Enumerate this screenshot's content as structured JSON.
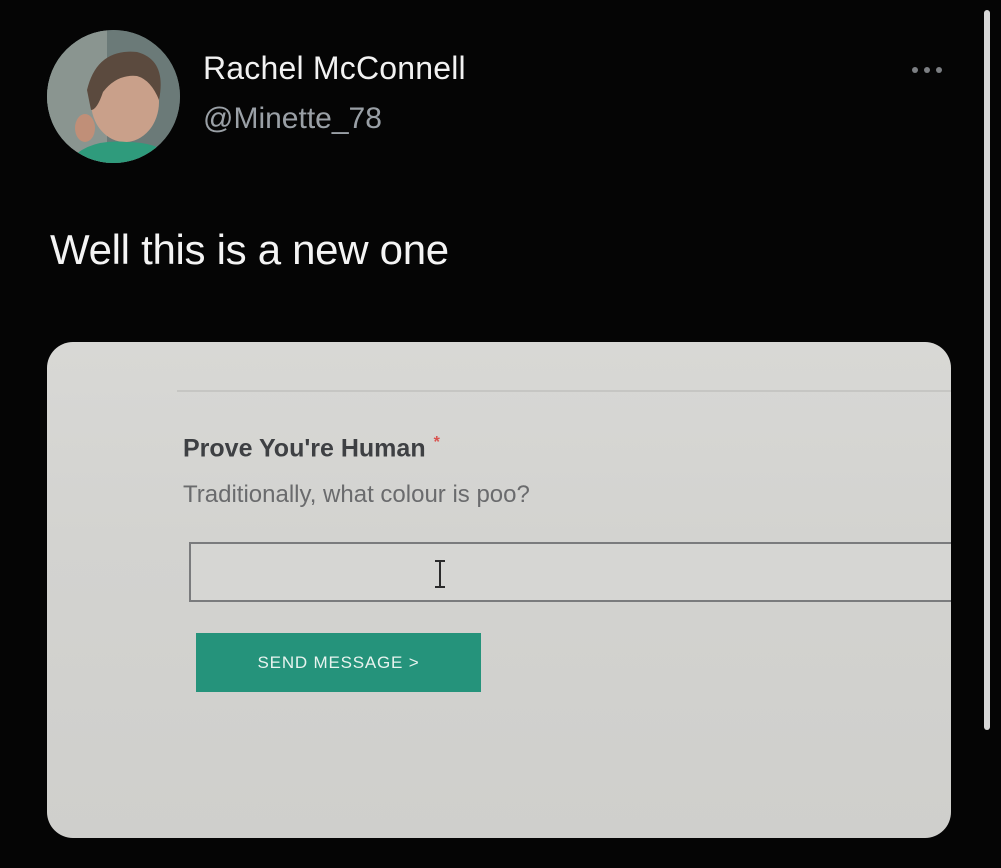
{
  "tweet": {
    "author": {
      "display_name": "Rachel McConnell",
      "handle": "@Minette_78",
      "avatar_icon": "user-avatar-photo"
    },
    "more_icon": "more-horizontal-icon",
    "text": "Well this is a new one"
  },
  "attached_photo": {
    "form": {
      "label": "Prove You're Human",
      "required_marker": "*",
      "question": "Traditionally, what colour is poo?",
      "input_value": "",
      "cursor_icon": "text-cursor-icon",
      "submit_label": "SEND MESSAGE >",
      "submit_color": "#25937b"
    }
  },
  "colors": {
    "background": "#050505",
    "primary_text": "#f2f2f2",
    "secondary_text": "#9aa0a6"
  }
}
